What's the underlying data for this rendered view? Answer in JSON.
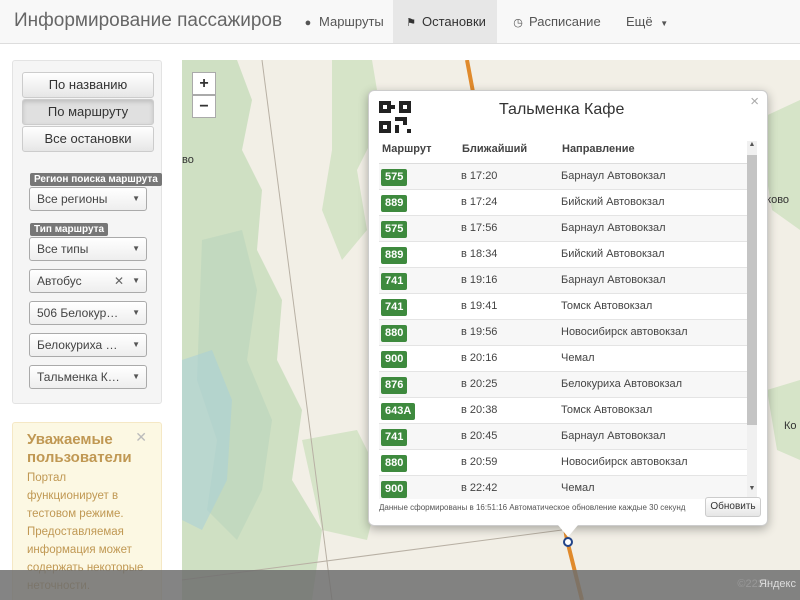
{
  "navbar": {
    "title": "Информирование пассажиров",
    "items": [
      {
        "label": "Маршруты",
        "icon": "map-marker-icon"
      },
      {
        "label": "Остановки",
        "icon": "flag-icon"
      },
      {
        "label": "Расписание",
        "icon": "clock-icon"
      },
      {
        "label": "Ещё",
        "icon": "caret-down-icon"
      }
    ],
    "active_item": "Остановки"
  },
  "search_buttons": [
    {
      "label": "По названию"
    },
    {
      "label": "По маршруту",
      "pressed": true
    },
    {
      "label": "Все остановки"
    }
  ],
  "filters": {
    "region_label": "Регион поиска маршрута",
    "region_value": "Все регионы",
    "type_label": "Тип маршрута",
    "type_value": "Все типы",
    "transport_value": "Автобус",
    "route_value": "506 Белокур…",
    "direction_value": "Белокуриха …",
    "stop_value": "Тальменка К…"
  },
  "notice": {
    "title": "Уважаемые пользователи",
    "text": "Портал функционирует в тестовом режиме. Предоставляемая информация может содержать некоторые неточности."
  },
  "map": {
    "zoom_in": "+",
    "zoom_out": "−",
    "labels": [
      "во",
      "иково",
      "Ко"
    ],
    "watermark": "Яндекс",
    "watermark_faded": "©2222"
  },
  "popup": {
    "stop_name": "Тальменка Кафе",
    "columns": [
      "Маршрут",
      "Ближайший",
      "Направление"
    ],
    "rows": [
      {
        "route": "575",
        "time": "в 17:20",
        "direction": "Барнаул Автовокзал"
      },
      {
        "route": "889",
        "time": "в 17:24",
        "direction": "Бийский Автовокзал"
      },
      {
        "route": "575",
        "time": "в 17:56",
        "direction": "Барнаул Автовокзал"
      },
      {
        "route": "889",
        "time": "в 18:34",
        "direction": "Бийский Автовокзал"
      },
      {
        "route": "741",
        "time": "в 19:16",
        "direction": "Барнаул Автовокзал"
      },
      {
        "route": "741",
        "time": "в 19:41",
        "direction": "Томск Автовокзал"
      },
      {
        "route": "880",
        "time": "в 19:56",
        "direction": "Новосибирск автовокзал"
      },
      {
        "route": "900",
        "time": "в 20:16",
        "direction": "Чемал"
      },
      {
        "route": "876",
        "time": "в 20:25",
        "direction": "Белокуриха Автовокзал"
      },
      {
        "route": "643А",
        "time": "в 20:38",
        "direction": "Томск Автовокзал"
      },
      {
        "route": "741",
        "time": "в 20:45",
        "direction": "Барнаул Автовокзал"
      },
      {
        "route": "880",
        "time": "в 20:59",
        "direction": "Новосибирск автовокзал"
      },
      {
        "route": "900",
        "time": "в 22:42",
        "direction": "Чемал"
      }
    ],
    "footer_text": "Данные сформированы в 16:51:16 Автоматическое обновление каждые 30 секунд",
    "refresh_label": "Обновить",
    "close_label": "×"
  },
  "colors": {
    "route_badge": "#3e8a3e",
    "notice_text": "#c09853",
    "map_bg": "#f2efe6"
  }
}
